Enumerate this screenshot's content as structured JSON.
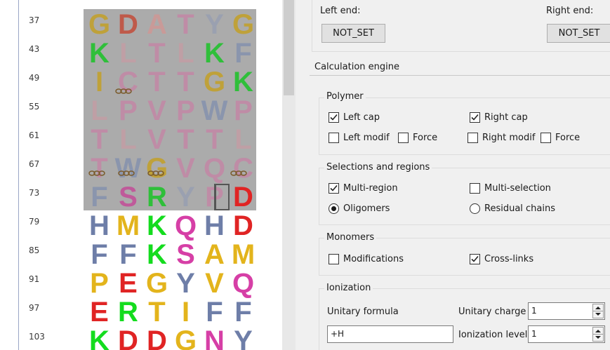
{
  "sequence": {
    "row_numbers": [
      "37",
      "43",
      "49",
      "55",
      "61",
      "67",
      "73",
      "79",
      "85",
      "91",
      "97",
      "103"
    ],
    "rows": [
      [
        "G",
        "D",
        "A",
        "T",
        "Y",
        "G"
      ],
      [
        "K",
        "L",
        "T",
        "L",
        "K",
        "F"
      ],
      [
        "I",
        "C",
        "T",
        "T",
        "G",
        "K"
      ],
      [
        "L",
        "P",
        "V",
        "P",
        "W",
        "P"
      ],
      [
        "T",
        "L",
        "V",
        "T",
        "T",
        "L"
      ],
      [
        "T",
        "W",
        "G",
        "V",
        "Q",
        "C"
      ],
      [
        "F",
        "S",
        "R",
        "Y",
        "P",
        "D"
      ],
      [
        "H",
        "M",
        "K",
        "Q",
        "H",
        "D"
      ],
      [
        "F",
        "F",
        "K",
        "S",
        "A",
        "M"
      ],
      [
        "P",
        "E",
        "G",
        "Y",
        "V",
        "Q"
      ],
      [
        "E",
        "R",
        "T",
        "I",
        "F",
        "F"
      ],
      [
        "K",
        "D",
        "D",
        "G",
        "N",
        "Y"
      ]
    ],
    "colors": {
      "G": "#e3b41c",
      "A": "#e3b41c",
      "T": "#e3b41c",
      "I": "#e3b41c",
      "L": "#e3b41c",
      "V": "#e3b41c",
      "P": "#e3b41c",
      "D": "#e02424",
      "E": "#e02424",
      "K": "#14dc1e",
      "R": "#14dc1e",
      "Y": "#6e7ea8",
      "F": "#6e7ea8",
      "W": "#6e7ea8",
      "H": "#6e7ea8",
      "C": "#e3b41c",
      "M": "#e3b41c",
      "S": "#d63fa6",
      "Q": "#d63fa6",
      "N": "#d63fa6"
    },
    "selected_colors": {
      "G": "#bfa13a",
      "D": "#bf5a4a",
      "A": "#c99a98",
      "T": "#bf8ca6",
      "Y": "#9aa0b0",
      "K": "#2fbf3a",
      "L": "#bf9fa5",
      "F": "#8a95ad",
      "I": "#bfa13a",
      "C": "#bf8ca6",
      "P": "#bf8ca6",
      "V": "#bf8ca6",
      "W": "#8a95ad",
      "Q": "#bf8ca6",
      "S": "#bf5a9a",
      "R": "#2fbf3a"
    }
  },
  "settings": {
    "left_end_label": "Left end:",
    "right_end_label": "Right end:",
    "left_end_button": "NOT_SET",
    "right_end_button": "NOT_SET",
    "calc_engine_title": "Calculation engine",
    "polymer": {
      "title": "Polymer",
      "left_cap": "Left cap",
      "left_cap_checked": true,
      "right_cap": "Right cap",
      "right_cap_checked": true,
      "left_modif": "Left modif",
      "left_modif_checked": false,
      "left_force": "Force",
      "left_force_checked": false,
      "right_modif": "Right modif",
      "right_modif_checked": false,
      "right_force": "Force",
      "right_force_checked": false
    },
    "selections": {
      "title": "Selections and regions",
      "multi_region": "Multi-region",
      "multi_region_checked": true,
      "multi_selection": "Multi-selection",
      "multi_selection_checked": false,
      "oligomers": "Oligomers",
      "oligomers_selected": true,
      "residual_chains": "Residual chains",
      "residual_chains_selected": false
    },
    "monomers": {
      "title": "Monomers",
      "modifications": "Modifications",
      "modifications_checked": false,
      "cross_links": "Cross-links",
      "cross_links_checked": true
    },
    "ionization": {
      "title": "Ionization",
      "unitary_formula_label": "Unitary formula",
      "unitary_formula_value": "+H",
      "unitary_charge_label": "Unitary charge",
      "unitary_charge_value": "1",
      "ionization_level_label": "Ionization level",
      "ionization_level_value": "1"
    }
  }
}
